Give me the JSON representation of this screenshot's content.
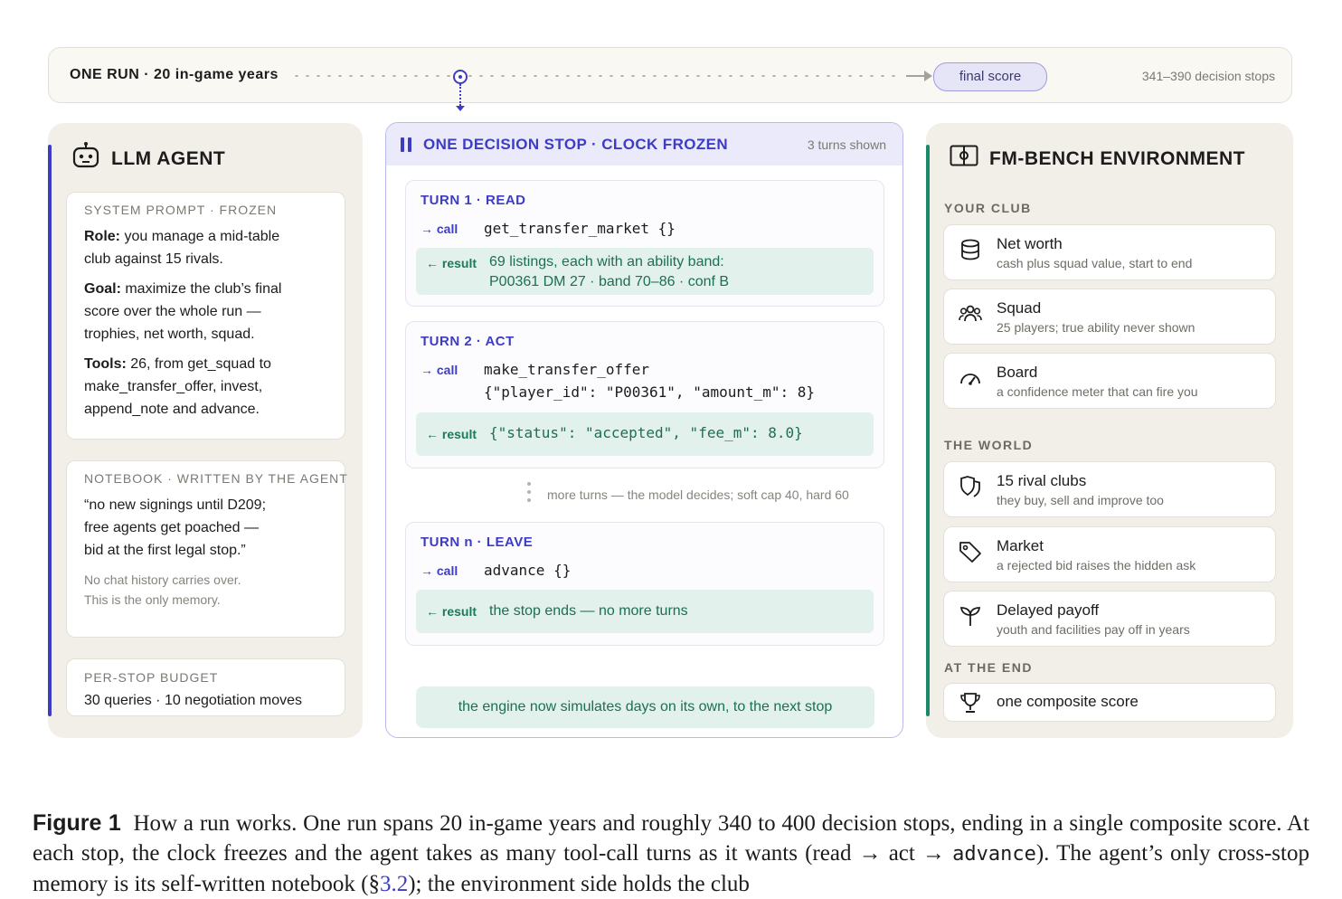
{
  "timeline": {
    "label": "ONE RUN · 20 in-game years",
    "final_label": "final score",
    "stops_label": "341–390 decision stops"
  },
  "agent": {
    "title": "LLM AGENT",
    "system_prompt": {
      "caption": "SYSTEM PROMPT · FROZEN",
      "role_key": "Role:",
      "role_line1": " you manage a mid-table",
      "role_line2": "club against 15 rivals.",
      "goal_key": "Goal:",
      "goal_line1": " maximize the club’s final",
      "goal_line2": "score over the whole run —",
      "goal_line3": "trophies, net worth, squad.",
      "tools_key": "Tools:",
      "tools_line1": " 26, from get_squad to",
      "tools_line2": "make_transfer_offer, invest,",
      "tools_line3": "append_note and advance."
    },
    "notebook": {
      "caption": "NOTEBOOK · WRITTEN BY THE AGENT",
      "quote_line1": "“no new signings until D209;",
      "quote_line2": "free agents get poached —",
      "quote_line3": "bid at the first legal stop.”",
      "note_line1": "No chat history carries over.",
      "note_line2": "This is the only memory."
    },
    "budget": {
      "caption": "PER-STOP BUDGET",
      "text": "30 queries · 10 negotiation moves"
    }
  },
  "stop": {
    "title": "ONE DECISION STOP · CLOCK FROZEN",
    "turns_shown": "3 turns shown",
    "call_label": "→ call",
    "result_label": "← result",
    "turn1": {
      "title": "TURN 1 · READ",
      "call": "get_transfer_market {}",
      "result_line1": "69 listings, each with an ability band:",
      "result_line2": "P00361 DM 27 · band 70–86 · conf B"
    },
    "turn2": {
      "title": "TURN 2 · ACT",
      "call_line1": "make_transfer_offer",
      "call_line2": "{\"player_id\": \"P00361\", \"amount_m\": 8}",
      "result": "{\"status\": \"accepted\", \"fee_m\": 8.0}"
    },
    "more_turns": "more turns — the model decides; soft cap 40, hard 60",
    "turnn": {
      "title": "TURN n · LEAVE",
      "call": "advance {}",
      "result": "the stop ends — no more turns"
    },
    "engine_note": "the engine now simulates days on its own, to the next stop"
  },
  "env": {
    "title": "FM-BENCH ENVIRONMENT",
    "your_club_caption": "YOUR CLUB",
    "world_caption": "THE WORLD",
    "end_caption": "AT THE END",
    "cards": [
      {
        "icon": "database-icon",
        "title": "Net worth",
        "sub": "cash plus squad value, start to end"
      },
      {
        "icon": "people-icon",
        "title": "Squad",
        "sub": "25 players; true ability never shown"
      },
      {
        "icon": "gauge-icon",
        "title": "Board",
        "sub": "a confidence meter that can fire you"
      },
      {
        "icon": "shields-icon",
        "title": "15 rival clubs",
        "sub": "they buy, sell and improve too"
      },
      {
        "icon": "tag-icon",
        "title": "Market",
        "sub": "a rejected bid raises the hidden ask"
      },
      {
        "icon": "sprout-icon",
        "title": "Delayed payoff",
        "sub": "youth and facilities pay off in years"
      },
      {
        "icon": "trophy-icon",
        "title": "one composite score",
        "sub": ""
      }
    ]
  },
  "caption": {
    "label": "Figure 1",
    "text1": "How a run works. One run spans 20 in-game years and roughly 340 to 400 decision stops, ending in a single composite score. At each stop, the clock freezes and the agent takes as many tool-call turns as it wants (read → act → ",
    "code": "advance",
    "text2": "). The agent’s only cross-stop memory is its self-written notebook (§",
    "section": "3.2",
    "text3": "); the environment side holds the club"
  },
  "colors": {
    "accent_purple": "#3d3cc4",
    "accent_green": "#1c8a68",
    "panel_bg": "#f2efe9",
    "result_bg": "#e3f1ec"
  }
}
